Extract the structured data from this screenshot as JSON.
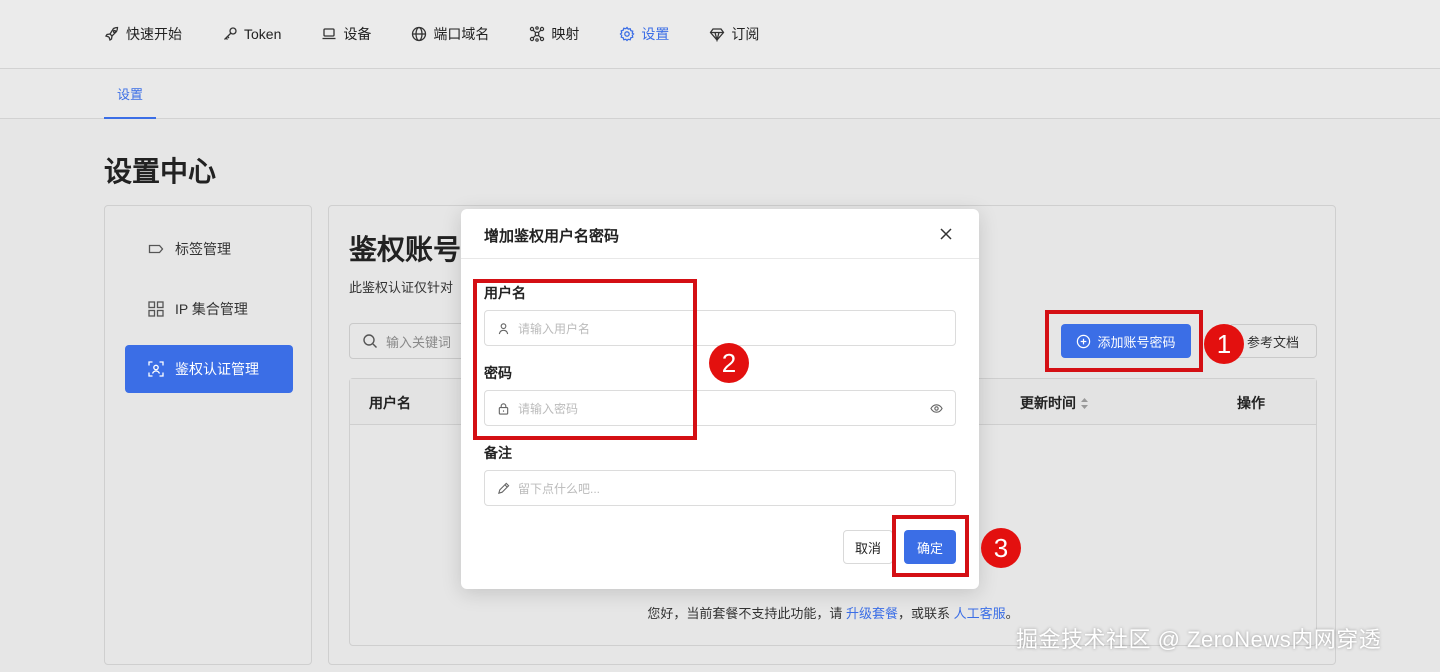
{
  "nav": {
    "items": [
      {
        "label": "快速开始",
        "icon": "rocket-icon"
      },
      {
        "label": "Token",
        "icon": "key-icon"
      },
      {
        "label": "设备",
        "icon": "laptop-icon"
      },
      {
        "label": "端口域名",
        "icon": "globe-icon"
      },
      {
        "label": "映射",
        "icon": "network-icon"
      },
      {
        "label": "设置",
        "icon": "gear-icon"
      },
      {
        "label": "订阅",
        "icon": "diamond-icon"
      }
    ],
    "active_index": 5,
    "accent_color": "#3b6ee6"
  },
  "subtab": {
    "label": "设置"
  },
  "page": {
    "title": "设置中心"
  },
  "sidebar": {
    "items": [
      {
        "label": "标签管理",
        "icon": "tag-icon"
      },
      {
        "label": "IP 集合管理",
        "icon": "grid-icon"
      },
      {
        "label": "鉴权认证管理",
        "icon": "face-scan-icon"
      }
    ],
    "active_index": 2
  },
  "main": {
    "title": "鉴权账号",
    "desc": "此鉴权认证仅针对",
    "search_placeholder": "输入关键词",
    "add_button": "添加账号密码",
    "doc_button": "参考文档",
    "table": {
      "columns": [
        "用户名",
        "更新时间",
        "操作"
      ]
    },
    "empty": {
      "prefix": "您好，当前套餐不支持此功能，请 ",
      "link1": "升级套餐",
      "middle": "，或联系 ",
      "link2": "人工客服",
      "suffix": "。"
    }
  },
  "modal": {
    "title": "增加鉴权用户名密码",
    "username_label": "用户名",
    "username_placeholder": "请输入用户名",
    "password_label": "密码",
    "password_placeholder": "请输入密码",
    "remark_label": "备注",
    "remark_placeholder": "留下点什么吧...",
    "cancel": "取消",
    "confirm": "确定"
  },
  "annotations": {
    "badges": [
      "1",
      "2",
      "3"
    ],
    "color": "#d40f14"
  },
  "watermark": "掘金技术社区 @ ZeroNews内网穿透"
}
